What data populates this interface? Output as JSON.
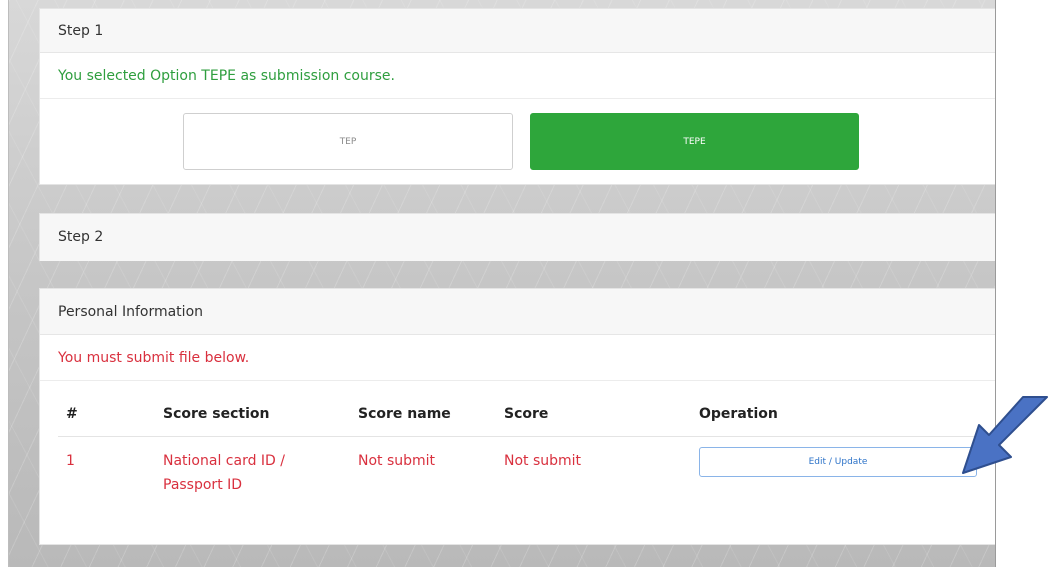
{
  "step1": {
    "header": "Step 1",
    "message": "You selected Option TEPE as submission course.",
    "options": [
      {
        "label": "TEP",
        "selected": false
      },
      {
        "label": "TEPE",
        "selected": true
      }
    ]
  },
  "step2": {
    "header": "Step 2"
  },
  "personal": {
    "header": "Personal Information",
    "message": "You must submit file below.",
    "columns": [
      "#",
      "Score section",
      "Score name",
      "Score",
      "Operation"
    ],
    "rows": [
      {
        "index": "1",
        "score_section": "National card ID / Passport ID",
        "score_name": "Not submit",
        "score": "Not submit",
        "operation_label": "Edit / Update"
      }
    ]
  },
  "colors": {
    "success": "#2ea63b",
    "error": "#d9303e",
    "link": "#2d73c8",
    "annotation_arrow": "#4a72c4"
  },
  "icons": {
    "annotation": "arrow-pointer-icon"
  }
}
